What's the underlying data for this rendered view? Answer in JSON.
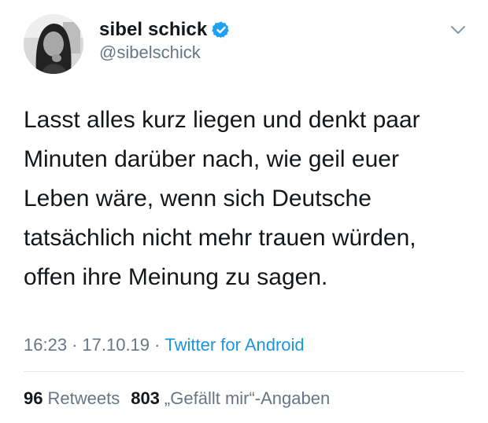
{
  "author": {
    "display_name": "sibel schick",
    "handle": "@sibelschick",
    "verified": true
  },
  "tweet": {
    "text": "Lasst alles kurz liegen und denkt paar\nMinuten darüber nach, wie geil euer\nLeben wäre, wenn sich Deutsche\ntatsächlich nicht mehr trauen würden,\noffen ihre Meinung zu sagen."
  },
  "meta": {
    "time": "16:23",
    "separator": "·",
    "date": "17.10.19",
    "source": "Twitter for Android"
  },
  "stats": {
    "retweets_count": "96",
    "retweets_label": "Retweets",
    "likes_count": "803",
    "likes_label": "„Gefällt mir“-Angaben"
  },
  "icons": {
    "verified": "verified-badge-icon",
    "menu": "chevron-down-icon"
  },
  "colors": {
    "text": "#14171a",
    "secondary": "#657786",
    "link": "#1b95e0",
    "verified": "#1da1f2",
    "divider": "#e1e8ed"
  }
}
